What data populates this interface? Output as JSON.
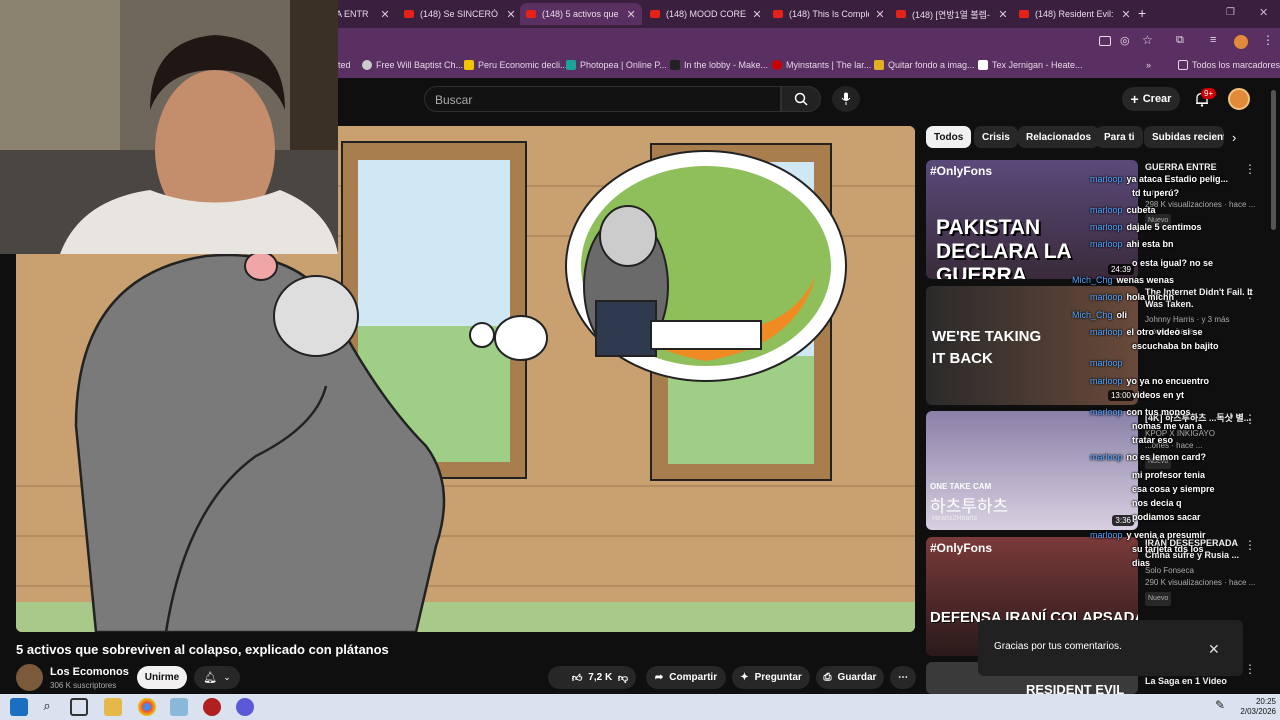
{
  "browser": {
    "tabs": [
      {
        "title": "A ENTR"
      },
      {
        "title": "(148) Se SINCERÓ co"
      },
      {
        "title": "(148) 5 activos que s"
      },
      {
        "title": "(148) MOOD COREA"
      },
      {
        "title": "(148) This Is Complet"
      },
      {
        "title": "(148) [연방1열 볼렙-"
      },
      {
        "title": "(148) Resident Evil: T"
      }
    ],
    "bookmarks": [
      {
        "label": "ted"
      },
      {
        "label": "Free Will Baptist Ch..."
      },
      {
        "label": "Peru Economic decli..."
      },
      {
        "label": "Photopea | Online P..."
      },
      {
        "label": "In the lobby - Make..."
      },
      {
        "label": "Myinstants | The lar..."
      },
      {
        "label": "Quitar fondo a imag..."
      },
      {
        "label": "Tex Jernigan - Heate..."
      }
    ],
    "all_bookmarks": "Todos los marcadores"
  },
  "youtube": {
    "search_placeholder": "Buscar",
    "create_label": "Crear",
    "notif_badge": "9+",
    "video_title": "5 activos que sobreviven al colapso, explicado con plátanos",
    "channel_name": "Los Ecomonos",
    "channel_subs": "306 K suscriptores",
    "join_label": "Unirme",
    "likes": "7,2 K",
    "share_label": "Compartir",
    "ask_label": "Preguntar",
    "save_label": "Guardar",
    "chips": [
      "Todos",
      "Crisis",
      "Relacionados",
      "Para ti",
      "Subidas recient"
    ],
    "sidebar": [
      {
        "thumb_text": "PAKISTAN DECLARA LA GUERRA",
        "thumb_tag": "#OnlyFons",
        "title": "GUERRA ENTRE",
        "channel": "...nseca",
        "views": "298 K visualizaciones · hace ...",
        "badge": "Nuevo",
        "duration": "24:39"
      },
      {
        "thumb_text": "WE'RE TAKING IT BACK",
        "title": "The Internet Didn't Fail. It Was Taken.",
        "channel": "Johnny Harris · y 3 más",
        "views": "...ones · hace ...",
        "duration": "13:00"
      },
      {
        "thumb_text": "하츠투하츠",
        "thumb_tag": "ONE TAKE CAM",
        "thumb_sub": "Hearts2Hearts",
        "title": "[4K] 하츠투하츠 ...독샷 별...",
        "channel": "KPOP X INKIGAYO",
        "views": "...ones · hace ...",
        "badge": "Nuevo",
        "duration": "3:36"
      },
      {
        "thumb_text": "DEFENSA IRANÍ COLAPSADA",
        "thumb_tag": "#OnlyFons",
        "title": "IRÁN DESESPERADA China sufre y Rusia ...",
        "channel": "Solo Fonseca",
        "views": "290 K visualizaciones · hace ...",
        "badge": "Nuevo"
      },
      {
        "thumb_text": "RESIDENT EVIL",
        "title": "La Saga en 1 Video"
      }
    ],
    "toast_text": "Gracias por tus comentarios."
  },
  "chat_overlay": [
    {
      "user": "marloop",
      "msg": "ya ataca Estadio pelig..."
    },
    {
      "user": "",
      "msg": "td tu perú?"
    },
    {
      "user": "marloop",
      "msg": "cubeta"
    },
    {
      "user": "marloop",
      "msg": "dajale 5 centimos"
    },
    {
      "user": "marloop",
      "msg": "ahi esta bn"
    },
    {
      "user": "",
      "msg": "o esta igual? no se"
    },
    {
      "user": "Mich_Chg",
      "msg": "wenas wenas"
    },
    {
      "user": "marloop",
      "msg": "hola michh"
    },
    {
      "user": "Mich_Chg",
      "msg": "oli"
    },
    {
      "user": "marloop",
      "msg": "el otro video si se"
    },
    {
      "user": "",
      "msg": "escuchaba bn bajito"
    },
    {
      "user": "marloop",
      "msg": ""
    },
    {
      "user": "marloop",
      "msg": "yo ya no encuentro"
    },
    {
      "user": "",
      "msg": "videos en yt"
    },
    {
      "user": "marloop",
      "msg": "con tus monos"
    },
    {
      "user": "",
      "msg": "nomas me van a"
    },
    {
      "user": "",
      "msg": "tratar eso"
    },
    {
      "user": "marloop",
      "msg": "no es lemon card?"
    },
    {
      "user": "",
      "msg": "mi profesor tenia"
    },
    {
      "user": "",
      "msg": "esa cosa y siempre"
    },
    {
      "user": "",
      "msg": "nos decia q"
    },
    {
      "user": "",
      "msg": "podiamos sacar"
    },
    {
      "user": "marloop",
      "msg": "y venia a presumir"
    },
    {
      "user": "",
      "msg": "su tarjeta tds los"
    },
    {
      "user": "",
      "msg": "dias"
    }
  ],
  "taskbar": {
    "time": "20:25",
    "date": "2/03/2026"
  },
  "colors": {
    "tabbar": "#3a1f3f",
    "toolbar": "#5a2f62",
    "yt_bg": "#0f0f0f",
    "chat_user": "#4fa3ff"
  }
}
